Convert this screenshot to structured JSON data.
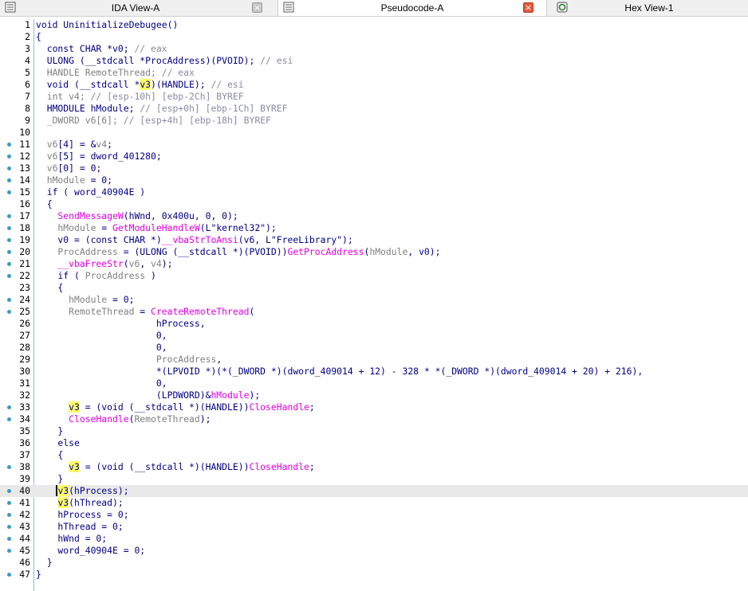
{
  "tabs": [
    {
      "label": "IDA View-A",
      "icon": "ida-view-icon",
      "close": "grey"
    },
    {
      "label": "Pseudocode-A",
      "icon": "pseudocode-icon",
      "close": "red",
      "active": true
    },
    {
      "label": "Hex View-1",
      "icon": "hex-view-icon"
    }
  ],
  "code_lines": [
    {
      "n": "1",
      "dot": false,
      "segs": [
        [
          "k",
          "void UninitializeDebugee()"
        ]
      ]
    },
    {
      "n": "2",
      "dot": false,
      "segs": [
        [
          "k",
          "{"
        ]
      ]
    },
    {
      "n": "3",
      "dot": false,
      "segs": [
        [
          "k",
          "  const CHAR *v0; "
        ],
        [
          "cm",
          "// eax"
        ]
      ]
    },
    {
      "n": "4",
      "dot": false,
      "segs": [
        [
          "k",
          "  ULONG (__stdcall *ProcAddress)(PVOID); "
        ],
        [
          "cm",
          "// esi"
        ]
      ]
    },
    {
      "n": "5",
      "dot": false,
      "segs": [
        [
          "vb",
          "  HANDLE RemoteThread; "
        ],
        [
          "cm",
          "// eax"
        ]
      ]
    },
    {
      "n": "6",
      "dot": false,
      "segs": [
        [
          "k",
          "  void (__stdcall *"
        ],
        [
          "hl",
          "v3"
        ],
        [
          "k",
          ")(HANDLE); "
        ],
        [
          "cm",
          "// esi"
        ]
      ]
    },
    {
      "n": "7",
      "dot": false,
      "segs": [
        [
          "vb",
          "  int v4; "
        ],
        [
          "cm",
          "// [esp-10h] [ebp-2Ch] BYREF"
        ]
      ]
    },
    {
      "n": "8",
      "dot": false,
      "segs": [
        [
          "k",
          "  HMODULE hModule; "
        ],
        [
          "cm",
          "// [esp+0h] [ebp-1Ch] BYREF"
        ]
      ]
    },
    {
      "n": "9",
      "dot": false,
      "segs": [
        [
          "vb",
          "  _DWORD v6[6]; "
        ],
        [
          "cm",
          "// [esp+4h] [ebp-18h] BYREF"
        ]
      ]
    },
    {
      "n": "10",
      "dot": false,
      "segs": []
    },
    {
      "n": "11",
      "dot": true,
      "segs": [
        [
          "vb",
          "  v6"
        ],
        [
          "k",
          "[4] = &"
        ],
        [
          "vb",
          "v4"
        ],
        [
          "k",
          ";"
        ]
      ]
    },
    {
      "n": "12",
      "dot": true,
      "segs": [
        [
          "vb",
          "  v6"
        ],
        [
          "k",
          "[5] = dword_401280;"
        ]
      ]
    },
    {
      "n": "13",
      "dot": true,
      "segs": [
        [
          "vb",
          "  v6"
        ],
        [
          "k",
          "[0] = 0;"
        ]
      ]
    },
    {
      "n": "14",
      "dot": true,
      "segs": [
        [
          "vb",
          "  hModule"
        ],
        [
          "k",
          " = 0;"
        ]
      ]
    },
    {
      "n": "15",
      "dot": true,
      "segs": [
        [
          "k",
          "  if ( word_40904E )"
        ]
      ]
    },
    {
      "n": "16",
      "dot": false,
      "segs": [
        [
          "k",
          "  {"
        ]
      ]
    },
    {
      "n": "17",
      "dot": true,
      "segs": [
        [
          "fn",
          "    SendMessageW"
        ],
        [
          "k",
          "(hWnd, 0x400u, 0, 0);"
        ]
      ]
    },
    {
      "n": "18",
      "dot": true,
      "segs": [
        [
          "vb",
          "    hModule"
        ],
        [
          "k",
          " = "
        ],
        [
          "fn",
          "GetModuleHandleW"
        ],
        [
          "k",
          "(L\""
        ],
        [
          "k",
          "kernel32"
        ],
        [
          "k",
          "\");"
        ]
      ]
    },
    {
      "n": "19",
      "dot": true,
      "segs": [
        [
          "k",
          "    v0 = (const CHAR *)"
        ],
        [
          "fn",
          "__vbaStrToAnsi"
        ],
        [
          "k",
          "(v6, L\""
        ],
        [
          "k",
          "FreeLibrary"
        ],
        [
          "k",
          "\");"
        ]
      ]
    },
    {
      "n": "20",
      "dot": true,
      "segs": [
        [
          "vb",
          "    ProcAddress"
        ],
        [
          "k",
          " = (ULONG (__stdcall *)(PVOID))"
        ],
        [
          "fn",
          "GetProcAddress"
        ],
        [
          "k",
          "("
        ],
        [
          "vb",
          "hModule"
        ],
        [
          "k",
          ", v0);"
        ]
      ]
    },
    {
      "n": "21",
      "dot": true,
      "segs": [
        [
          "fn",
          "    __vbaFreeStr"
        ],
        [
          "k",
          "("
        ],
        [
          "vb",
          "v6"
        ],
        [
          "k",
          ", "
        ],
        [
          "vb",
          "v4"
        ],
        [
          "k",
          ");"
        ]
      ]
    },
    {
      "n": "22",
      "dot": true,
      "segs": [
        [
          "k",
          "    if ( "
        ],
        [
          "vb",
          "ProcAddress"
        ],
        [
          "k",
          " )"
        ]
      ]
    },
    {
      "n": "23",
      "dot": false,
      "segs": [
        [
          "k",
          "    {"
        ]
      ]
    },
    {
      "n": "24",
      "dot": true,
      "segs": [
        [
          "vb",
          "      hModule"
        ],
        [
          "k",
          " = 0;"
        ]
      ]
    },
    {
      "n": "25",
      "dot": true,
      "segs": [
        [
          "vb",
          "      RemoteThread"
        ],
        [
          "k",
          " = "
        ],
        [
          "fn",
          "CreateRemoteThread"
        ],
        [
          "k",
          "("
        ]
      ]
    },
    {
      "n": "26",
      "dot": false,
      "segs": [
        [
          "k",
          "                      hProcess,"
        ]
      ]
    },
    {
      "n": "27",
      "dot": false,
      "segs": [
        [
          "k",
          "                      0,"
        ]
      ]
    },
    {
      "n": "28",
      "dot": false,
      "segs": [
        [
          "k",
          "                      0,"
        ]
      ]
    },
    {
      "n": "29",
      "dot": false,
      "segs": [
        [
          "vb",
          "                      ProcAddress"
        ],
        [
          "k",
          ","
        ]
      ]
    },
    {
      "n": "30",
      "dot": false,
      "segs": [
        [
          "k",
          "                      *(LPVOID *)(*(_DWORD *)(dword_409014 + 12) - 328 * *(_DWORD *)(dword_409014 + 20) + 216),"
        ]
      ]
    },
    {
      "n": "31",
      "dot": false,
      "segs": [
        [
          "k",
          "                      0,"
        ]
      ]
    },
    {
      "n": "32",
      "dot": false,
      "segs": [
        [
          "k",
          "                      (LPDWORD)&"
        ],
        [
          "fn",
          "hModule"
        ],
        [
          "k",
          ");"
        ]
      ]
    },
    {
      "n": "33",
      "dot": true,
      "segs": [
        [
          "k",
          "      "
        ],
        [
          "hl",
          "v3"
        ],
        [
          "k",
          " = (void (__stdcall *)(HANDLE))"
        ],
        [
          "fn",
          "CloseHandle"
        ],
        [
          "k",
          ";"
        ]
      ]
    },
    {
      "n": "34",
      "dot": true,
      "segs": [
        [
          "fn",
          "      CloseHandle"
        ],
        [
          "k",
          "("
        ],
        [
          "vb",
          "RemoteThread"
        ],
        [
          "k",
          ");"
        ]
      ]
    },
    {
      "n": "35",
      "dot": false,
      "segs": [
        [
          "k",
          "    }"
        ]
      ]
    },
    {
      "n": "36",
      "dot": false,
      "segs": [
        [
          "k",
          "    else"
        ]
      ]
    },
    {
      "n": "37",
      "dot": false,
      "segs": [
        [
          "k",
          "    {"
        ]
      ]
    },
    {
      "n": "38",
      "dot": true,
      "segs": [
        [
          "k",
          "      "
        ],
        [
          "hl",
          "v3"
        ],
        [
          "k",
          " = (void (__stdcall *)(HANDLE))"
        ],
        [
          "fn",
          "CloseHandle"
        ],
        [
          "k",
          ";"
        ]
      ]
    },
    {
      "n": "39",
      "dot": false,
      "segs": [
        [
          "k",
          "    }"
        ]
      ]
    },
    {
      "n": "40",
      "dot": true,
      "cur": true,
      "segs": [
        [
          "k",
          "    "
        ],
        [
          "hlc",
          "v3"
        ],
        [
          "k",
          "(hProcess);"
        ]
      ]
    },
    {
      "n": "41",
      "dot": true,
      "segs": [
        [
          "k",
          "    "
        ],
        [
          "hl",
          "v3"
        ],
        [
          "k",
          "(hThread);"
        ]
      ]
    },
    {
      "n": "42",
      "dot": true,
      "segs": [
        [
          "k",
          "    hProcess = 0;"
        ]
      ]
    },
    {
      "n": "43",
      "dot": true,
      "segs": [
        [
          "k",
          "    hThread = 0;"
        ]
      ]
    },
    {
      "n": "44",
      "dot": true,
      "segs": [
        [
          "k",
          "    hWnd = 0;"
        ]
      ]
    },
    {
      "n": "45",
      "dot": true,
      "segs": [
        [
          "k",
          "    word_40904E = 0;"
        ]
      ]
    },
    {
      "n": "46",
      "dot": false,
      "segs": [
        [
          "k",
          "  }"
        ]
      ]
    },
    {
      "n": "47",
      "dot": true,
      "segs": [
        [
          "k",
          "}"
        ]
      ]
    }
  ]
}
